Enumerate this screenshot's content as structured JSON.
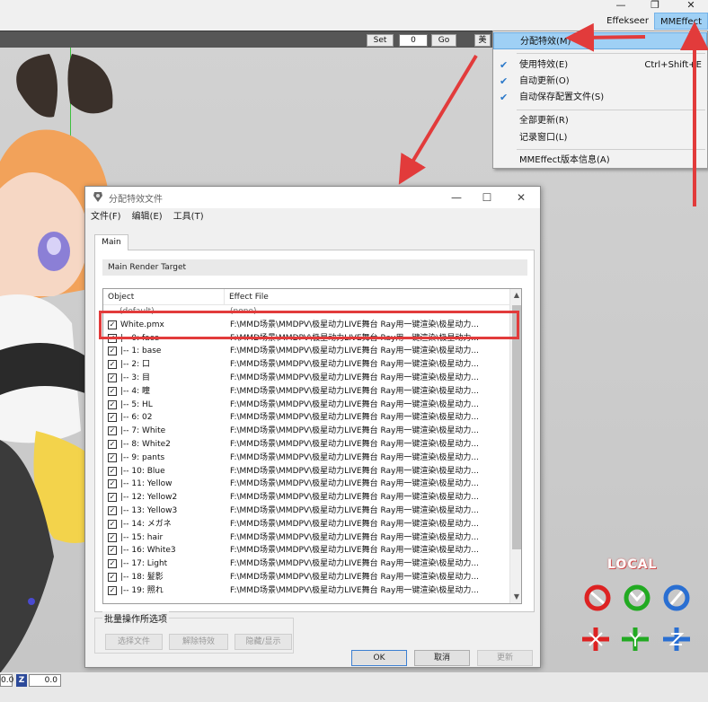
{
  "window_controls": {
    "minimize": "—",
    "restore": "❐",
    "close": "✕"
  },
  "menubar": {
    "items": [
      "Effekseer",
      "MMEffect"
    ]
  },
  "toolbar": {
    "set_label": "Set",
    "frame_value": "0",
    "go_label": "Go",
    "partial_label": "美"
  },
  "dropdown": {
    "items": [
      {
        "label": "分配特效(M)",
        "checked": false,
        "highlighted": true,
        "shortcut": ""
      },
      {
        "label": "使用特效(E)",
        "checked": true,
        "highlighted": false,
        "shortcut": "Ctrl+Shift+E"
      },
      {
        "label": "自动更新(O)",
        "checked": true,
        "highlighted": false,
        "shortcut": ""
      },
      {
        "label": "自动保存配置文件(S)",
        "checked": true,
        "highlighted": false,
        "shortcut": ""
      },
      {
        "label": "全部更新(R)",
        "checked": false,
        "highlighted": false,
        "shortcut": ""
      },
      {
        "label": "记录窗口(L)",
        "checked": false,
        "highlighted": false,
        "shortcut": ""
      },
      {
        "label": "MMEffect版本信息(A)",
        "checked": false,
        "highlighted": false,
        "shortcut": ""
      }
    ]
  },
  "dialog": {
    "title": "分配特效文件",
    "menus": [
      "文件(F)",
      "编辑(E)",
      "工具(T)"
    ],
    "tab_label": "Main",
    "render_target": "Main Render Target",
    "columns": {
      "object": "Object",
      "effect": "Effect File"
    },
    "rows": [
      {
        "object": "(default)",
        "effect": "(none)",
        "checkbox": false
      },
      {
        "object": "White.pmx",
        "effect": "F:\\MMD场景\\MMDPV\\极星动力LIVE舞台 Ray用一键渲染\\极星动力...",
        "checkbox": true
      },
      {
        "object": "|-- 0: face",
        "effect": "F:\\MMD场景\\MMDPV\\极星动力LIVE舞台 Ray用一键渲染\\极星动力...",
        "checkbox": true
      },
      {
        "object": "|-- 1: base",
        "effect": "F:\\MMD场景\\MMDPV\\极星动力LIVE舞台 Ray用一键渲染\\极星动力...",
        "checkbox": true
      },
      {
        "object": "|-- 2: 口",
        "effect": "F:\\MMD场景\\MMDPV\\极星动力LIVE舞台 Ray用一键渲染\\极星动力...",
        "checkbox": true
      },
      {
        "object": "|-- 3: 目",
        "effect": "F:\\MMD场景\\MMDPV\\极星动力LIVE舞台 Ray用一键渲染\\极星动力...",
        "checkbox": true
      },
      {
        "object": "|-- 4: 瞳",
        "effect": "F:\\MMD场景\\MMDPV\\极星动力LIVE舞台 Ray用一键渲染\\极星动力...",
        "checkbox": true
      },
      {
        "object": "|-- 5: HL",
        "effect": "F:\\MMD场景\\MMDPV\\极星动力LIVE舞台 Ray用一键渲染\\极星动力...",
        "checkbox": true
      },
      {
        "object": "|-- 6: 02",
        "effect": "F:\\MMD场景\\MMDPV\\极星动力LIVE舞台 Ray用一键渲染\\极星动力...",
        "checkbox": true
      },
      {
        "object": "|-- 7: White",
        "effect": "F:\\MMD场景\\MMDPV\\极星动力LIVE舞台 Ray用一键渲染\\极星动力...",
        "checkbox": true
      },
      {
        "object": "|-- 8: White2",
        "effect": "F:\\MMD场景\\MMDPV\\极星动力LIVE舞台 Ray用一键渲染\\极星动力...",
        "checkbox": true
      },
      {
        "object": "|-- 9: pants",
        "effect": "F:\\MMD场景\\MMDPV\\极星动力LIVE舞台 Ray用一键渲染\\极星动力...",
        "checkbox": true
      },
      {
        "object": "|-- 10: Blue",
        "effect": "F:\\MMD场景\\MMDPV\\极星动力LIVE舞台 Ray用一键渲染\\极星动力...",
        "checkbox": true
      },
      {
        "object": "|-- 11: Yellow",
        "effect": "F:\\MMD场景\\MMDPV\\极星动力LIVE舞台 Ray用一键渲染\\极星动力...",
        "checkbox": true
      },
      {
        "object": "|-- 12: Yellow2",
        "effect": "F:\\MMD场景\\MMDPV\\极星动力LIVE舞台 Ray用一键渲染\\极星动力...",
        "checkbox": true
      },
      {
        "object": "|-- 13: Yellow3",
        "effect": "F:\\MMD场景\\MMDPV\\极星动力LIVE舞台 Ray用一键渲染\\极星动力...",
        "checkbox": true
      },
      {
        "object": "|-- 14: メガネ",
        "effect": "F:\\MMD场景\\MMDPV\\极星动力LIVE舞台 Ray用一键渲染\\极星动力...",
        "checkbox": true
      },
      {
        "object": "|-- 15: hair",
        "effect": "F:\\MMD场景\\MMDPV\\极星动力LIVE舞台 Ray用一键渲染\\极星动力...",
        "checkbox": true
      },
      {
        "object": "|-- 16: White3",
        "effect": "F:\\MMD场景\\MMDPV\\极星动力LIVE舞台 Ray用一键渲染\\极星动力...",
        "checkbox": true
      },
      {
        "object": "|-- 17: Light",
        "effect": "F:\\MMD场景\\MMDPV\\极星动力LIVE舞台 Ray用一键渲染\\极星动力...",
        "checkbox": true
      },
      {
        "object": "|-- 18: 髮影",
        "effect": "F:\\MMD场景\\MMDPV\\极星动力LIVE舞台 Ray用一键渲染\\极星动力...",
        "checkbox": true
      },
      {
        "object": "|-- 19: 照れ",
        "effect": "F:\\MMD场景\\MMDPV\\极星动力LIVE舞台 Ray用一键渲染\\极星动力...",
        "checkbox": true
      }
    ],
    "bulk": {
      "legend": "批量操作所选项",
      "select_file": "选择文件",
      "remove_effect": "解除特效",
      "hide_show": "隐藏/显示"
    },
    "ok_label": "OK",
    "cancel_label": "取消",
    "update_label": "更新"
  },
  "gizmo": {
    "label": "LOCAL"
  },
  "bottom": {
    "x_value": "0.0",
    "z_tag": "Z",
    "z_value": "0.0"
  },
  "colors": {
    "accent": "#9fd0f5",
    "annotation": "#e23b3b"
  },
  "icons": [
    "checkmark-icon",
    "app-icon",
    "minimize-icon",
    "maximize-icon",
    "close-icon",
    "scroll-up-icon",
    "scroll-down-icon",
    "rotate-x-icon",
    "rotate-y-icon",
    "rotate-z-icon",
    "move-x-icon",
    "move-y-icon",
    "move-z-icon"
  ]
}
